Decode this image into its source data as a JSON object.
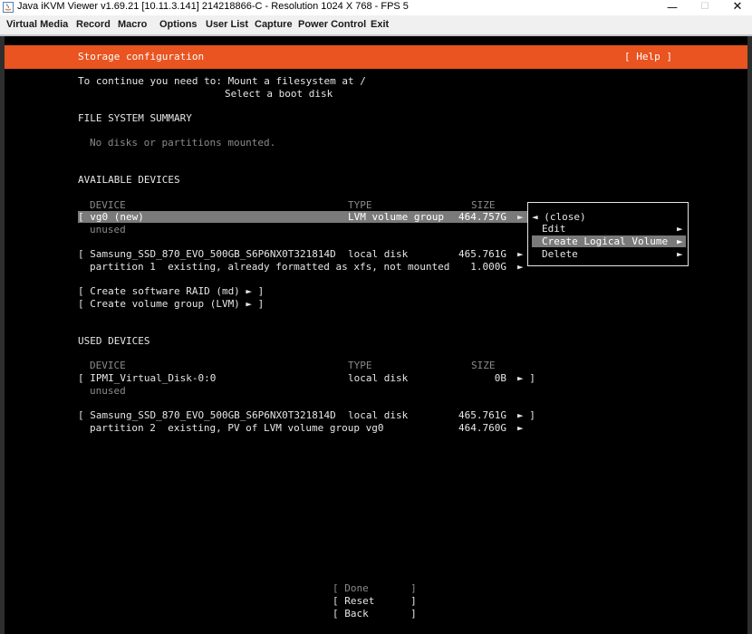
{
  "window": {
    "title": "Java iKVM Viewer v1.69.21 [10.11.3.141] 214218866-C - Resolution 1024 X 768 - FPS 5",
    "minimize_glyph": "—",
    "maximize_glyph": "☐",
    "close_glyph": "✕"
  },
  "menubar": {
    "items": [
      "Virtual Media",
      "Record",
      "Macro",
      "Options",
      "User List",
      "Capture",
      "Power Control",
      "Exit"
    ]
  },
  "installer": {
    "header_title": "Storage configuration",
    "help_label": "[ Help ]",
    "intro_line1": "To continue you need to: Mount a filesystem at /",
    "intro_line2": "Select a boot disk",
    "fs_summary_heading": "FILE SYSTEM SUMMARY",
    "fs_summary_empty": "No disks or partitions mounted.",
    "available_heading": "AVAILABLE DEVICES",
    "col_device": "DEVICE",
    "col_type": "TYPE",
    "col_size": "SIZE",
    "available": {
      "vg0": {
        "device": "[ vg0 (new)",
        "type": "LVM volume group",
        "size": "464.757G",
        "arrow": "►",
        "sub": "unused"
      },
      "ssd": {
        "device": "[ Samsung_SSD_870_EVO_500GB_S6P6NX0T321814D",
        "type": "local disk",
        "size": "465.761G",
        "arrow": "►"
      },
      "ssd_part1": {
        "device": "partition 1  existing, already formatted as xfs, not mounted",
        "size": "1.000G",
        "arrow": "►"
      },
      "create_raid": "[ Create software RAID (md) ► ]",
      "create_vg": "[ Create volume group (LVM) ► ]"
    },
    "used_heading": "USED DEVICES",
    "used": {
      "ipmi": {
        "device": "[ IPMI_Virtual_Disk-0:0",
        "type": "local disk",
        "size": "0B",
        "arrow": "► ]",
        "sub": "unused"
      },
      "ssd": {
        "device": "[ Samsung_SSD_870_EVO_500GB_S6P6NX0T321814D",
        "type": "local disk",
        "size": "465.761G",
        "arrow": "► ]"
      },
      "ssd_part2": {
        "device": "partition 2  existing, PV of LVM volume group vg0",
        "size": "464.760G",
        "arrow": "►"
      }
    },
    "context_menu": {
      "close": "◄ (close)",
      "edit": "Edit",
      "create_lv": "Create Logical Volume",
      "delete": "Delete",
      "arrow": "►"
    },
    "buttons": {
      "done": "[ Done       ]",
      "reset": "[ Reset      ]",
      "back": "[ Back       ]"
    }
  },
  "colors": {
    "accent": "#e95420",
    "highlight": "#7a7a7a",
    "terminal_bg": "#000000",
    "text": "#e6e6e6",
    "dim_text": "#8a8a8a"
  }
}
